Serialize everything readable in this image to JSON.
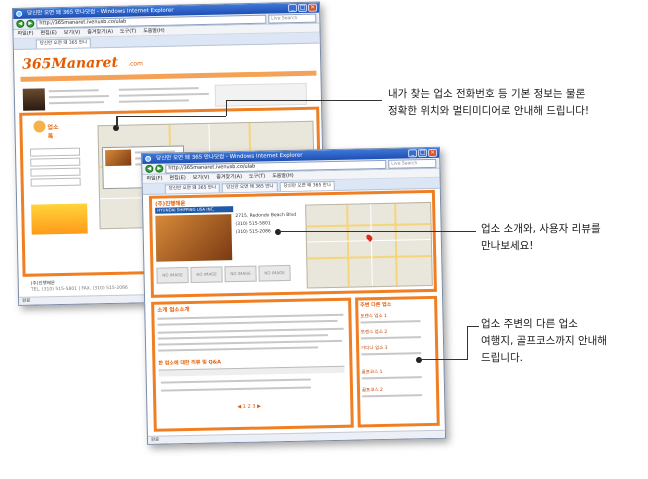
{
  "back_window": {
    "title": "당신만 오면 돼 365 만나닷컴 - Windows Internet Explorer",
    "url": "http://365manaret.ivenusb.co/ulab",
    "menu": [
      "파일(F)",
      "편집(E)",
      "보기(V)",
      "즐겨찾기(A)",
      "도구(T)",
      "도움말(H)"
    ],
    "tabs": [
      "당신만 오면 돼 365 만나"
    ],
    "site_logo": "365Manaret",
    "site_logo_sub": ".com",
    "section_label": "업소록",
    "business_name": "(주)진행해운",
    "footer_addr": "TEL. (310) 515-5801 | FAX. (310) 515-2086",
    "status": "완료"
  },
  "front_window": {
    "title": "당신만 오면 돼 365 만나닷컴 - Windows Internet Explorer",
    "url": "http://365manaret.ivenusb.co/ulab",
    "menu": [
      "파일(F)",
      "편집(E)",
      "보기(V)",
      "즐겨찾기(A)",
      "도구(T)",
      "도움말(H)"
    ],
    "tabs": [
      "당신만 오면 돼 365 만나",
      "당신만 오면 돼 365 만나",
      "당신만 오면 돼 365 만나"
    ],
    "company_header": "(주)진행해운",
    "company_eng": "HYUNDAI SHIPPING USA INC.",
    "info_lines": [
      "2715. Redondo Beach Blvd",
      "(310) 515-5801",
      "(310) 515-2086"
    ],
    "intro_label": "소개 업소소개",
    "review_label": "한 업소에 대한 리뷰 및 Q&A",
    "nearby_label": "주변 다른 업소",
    "nearby_items": [
      "토렌스 업소 1",
      "토렌스 업소 2",
      "가디나 업소 3",
      "골프코스 1",
      "골프코스 2"
    ],
    "pager": "◀ 1 2 3 ▶",
    "status": "완료"
  },
  "callouts": {
    "top": {
      "line1": "내가 찾는 업소 전화번호 등 기본 정보는 물론",
      "line2": "정확한 위치와 멀티미디어로 안내해 드립니다!"
    },
    "middle": {
      "line1": "업소 소개와, 사용자 리뷰를",
      "line2": "만나보세요!"
    },
    "bottom": {
      "line1": "업소 주변의 다른 업소",
      "line2": "여행지, 골프코스까지 안내해",
      "line3": "드립니다."
    }
  },
  "colors": {
    "accent": "#f07e22",
    "brand": "#e35a00",
    "titlebar": "#2a5fc4"
  }
}
